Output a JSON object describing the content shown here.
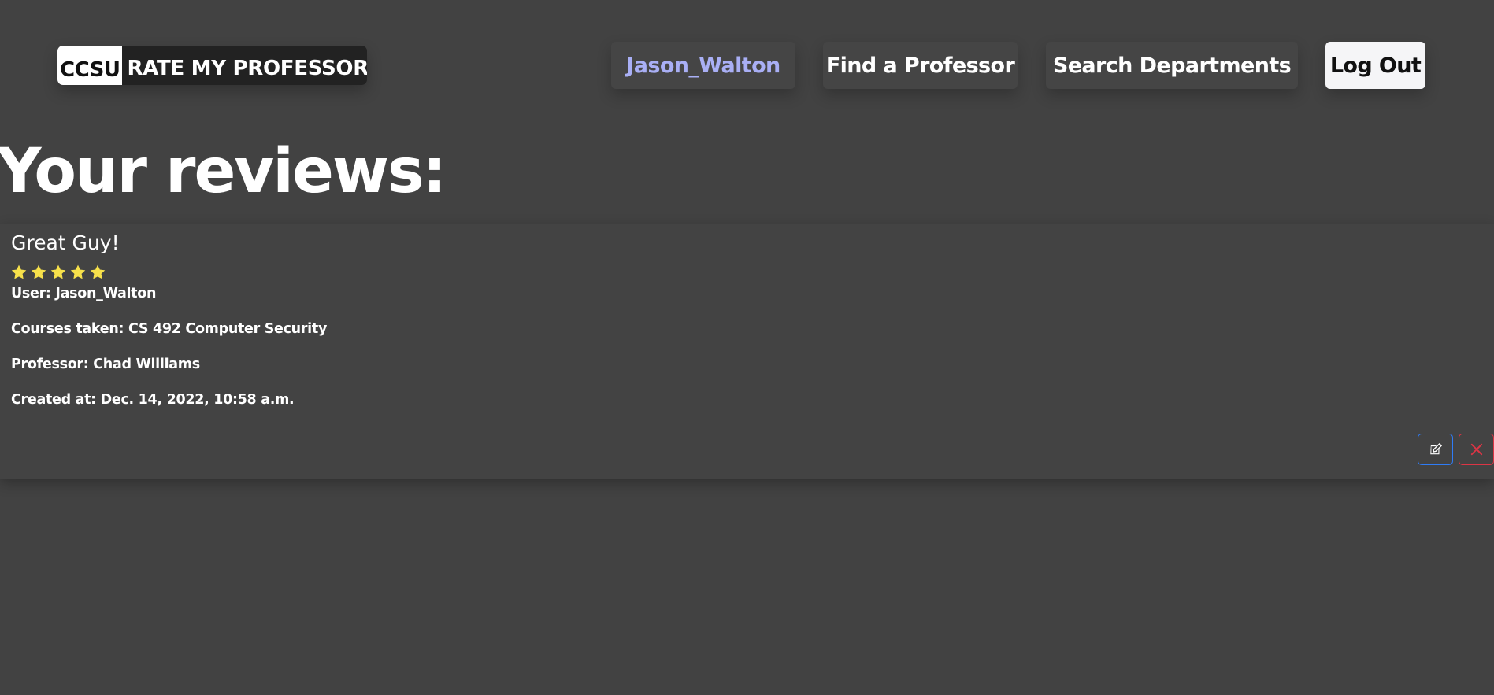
{
  "header": {
    "logo_ccsu": "CCSU",
    "logo_title": "RATE MY PROFESSOR",
    "nav": {
      "username": "Jason_Walton",
      "find_professor": "Find a Professor",
      "search_departments": "Search Departments",
      "logout": "Log Out"
    }
  },
  "main": {
    "title": "Your reviews:",
    "reviews": [
      {
        "title": "Great Guy!",
        "rating": 5,
        "rating_max": 5,
        "user": "User: Jason_Walton",
        "courses": "Courses taken: CS 492 Computer Security",
        "professor": "Professor: Chad Williams",
        "created": "Created at: Dec. 14, 2022, 10:58 a.m.",
        "actions": {
          "edit_icon": "edit-icon",
          "delete_icon": "close-icon"
        }
      }
    ]
  },
  "colors": {
    "background": "#424242",
    "star": "#f7e14b",
    "username_link": "#a9aff5",
    "edit_border": "#2f7cf6",
    "delete_border": "#dc3545"
  }
}
